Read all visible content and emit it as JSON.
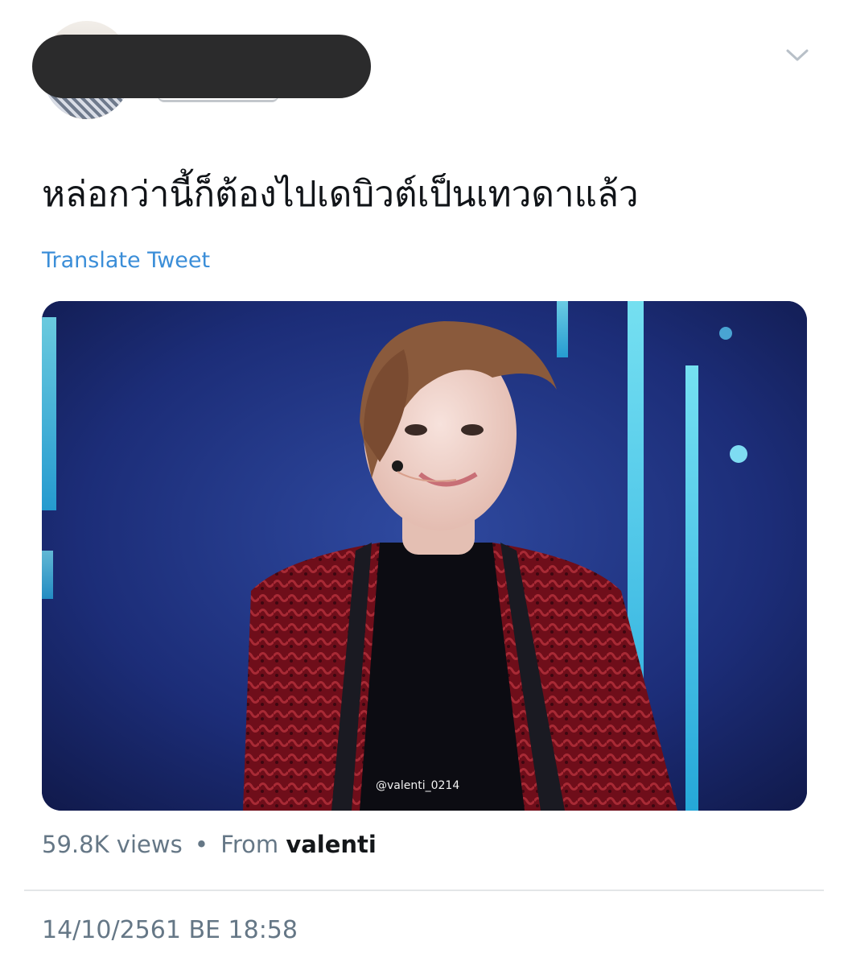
{
  "header": {
    "menu_icon": "chevron-down-icon"
  },
  "tweet": {
    "text": "หล่อกว่านี้ก็ต้องไปเดบิวต์เป็นเทวดาแล้ว",
    "translate_label": "Translate Tweet"
  },
  "media": {
    "watermark": "@valenti_0214"
  },
  "meta": {
    "views": "59.8K views",
    "separator": "•",
    "from_label": "From",
    "source": "valenti"
  },
  "timestamp": "14/10/2561 BE 18:58",
  "colors": {
    "link": "#3b8ed8",
    "secondary_text": "#657786",
    "primary_text": "#14171a"
  }
}
